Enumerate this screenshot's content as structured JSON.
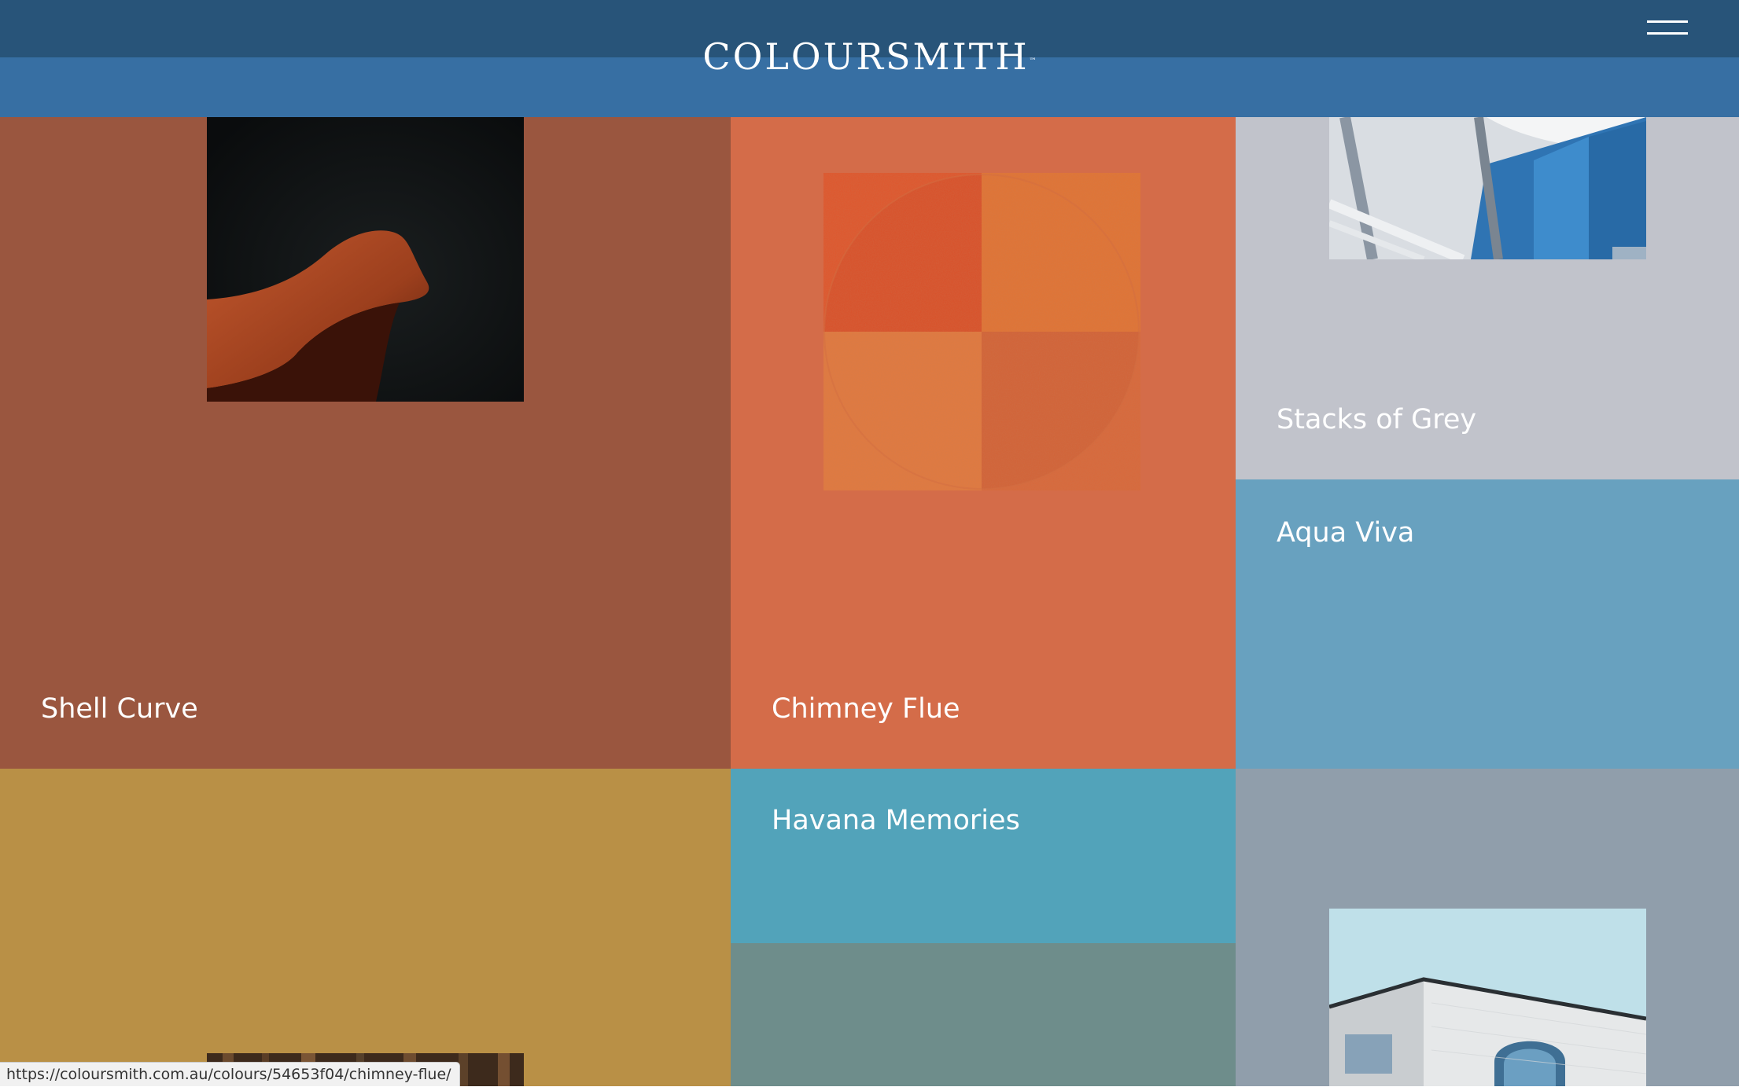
{
  "header": {
    "logo_text": "COLOURSMITH",
    "trademark": "™",
    "menu_icon": "hamburger-menu-icon",
    "colors": {
      "top": "#285479",
      "band": "#376fa3"
    }
  },
  "tiles": [
    {
      "name": "Shell Curve",
      "color": "#9a563f",
      "image": "orange-chair-photo"
    },
    {
      "name": "Chimney Flue",
      "color": "#d46c49",
      "image": "rust-texture-artwork"
    },
    {
      "name": "Stacks of Grey",
      "color": "#c1c3cb",
      "image": "blue-building-structure-photo"
    },
    {
      "name": "Aqua Viva",
      "color": "#68a1bf"
    },
    {
      "name": "",
      "color": "#b99046",
      "image": "forest-photo"
    },
    {
      "name": "Havana Memories",
      "color": "#52a3ba"
    },
    {
      "name": "",
      "color": "#6e8d8b"
    },
    {
      "name": "",
      "color": "#909eab",
      "image": "white-building-sky-photo"
    }
  ],
  "status_bar": {
    "url": "https://coloursmith.com.au/colours/54653f04/chimney-flue/"
  }
}
